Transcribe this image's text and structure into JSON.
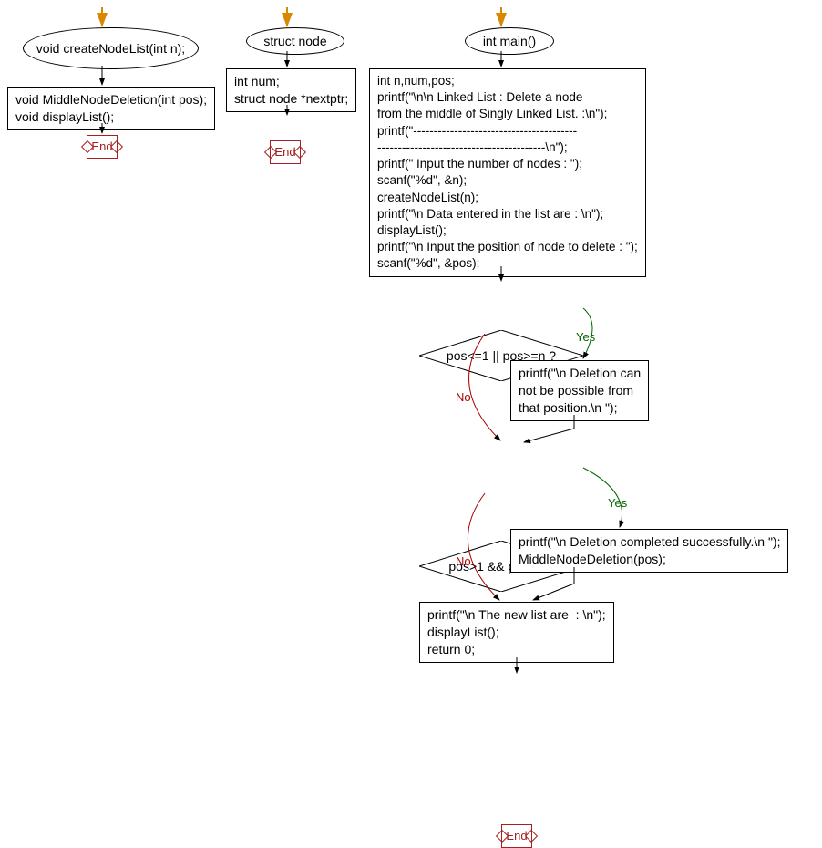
{
  "colA": {
    "start": "void createNodeList(int n);",
    "block": "void MiddleNodeDeletion(int pos);\nvoid displayList();",
    "end": "End"
  },
  "colB": {
    "start": "struct node",
    "block": "int num;\nstruct node *nextptr;",
    "end": "End"
  },
  "colC": {
    "start": "int main()",
    "block1": "int n,num,pos;\nprintf(\"\\n\\n Linked List : Delete a node\nfrom the middle of Singly Linked List. :\\n\");\nprintf(\"----------------------------------------\n-----------------------------------------\\n\");\nprintf(\" Input the number of nodes : \");\nscanf(\"%d\", &n);\ncreateNodeList(n);\nprintf(\"\\n Data entered in the list are : \\n\");\ndisplayList();\nprintf(\"\\n Input the position of node to delete : \");\nscanf(\"%d\", &pos);",
    "cond1": "pos<=1 || pos>=n ?",
    "yesBlock1": "printf(\"\\n Deletion can\nnot be possible from\nthat position.\\n \");",
    "cond2": "pos>1 && pos<n ?",
    "yesBlock2": "printf(\"\\n Deletion completed successfully.\\n \");\nMiddleNodeDeletion(pos);",
    "finalBlock": "printf(\"\\n The new list are  : \\n\");\ndisplayList();\nreturn 0;",
    "end": "End"
  },
  "labels": {
    "yes": "Yes",
    "no": "No"
  },
  "chart_data": {
    "type": "flowchart",
    "subcharts": [
      {
        "id": "A",
        "nodes": [
          {
            "id": "A1",
            "shape": "terminator",
            "text": "void createNodeList(int n);"
          },
          {
            "id": "A2",
            "shape": "process",
            "text": "void MiddleNodeDeletion(int pos);\nvoid displayList();"
          },
          {
            "id": "A3",
            "shape": "end",
            "text": "End"
          }
        ],
        "edges": [
          {
            "from": "entry",
            "to": "A1"
          },
          {
            "from": "A1",
            "to": "A2"
          },
          {
            "from": "A2",
            "to": "A3"
          }
        ]
      },
      {
        "id": "B",
        "nodes": [
          {
            "id": "B1",
            "shape": "terminator",
            "text": "struct node"
          },
          {
            "id": "B2",
            "shape": "process",
            "text": "int num;\nstruct node *nextptr;"
          },
          {
            "id": "B3",
            "shape": "end",
            "text": "End"
          }
        ],
        "edges": [
          {
            "from": "entry",
            "to": "B1"
          },
          {
            "from": "B1",
            "to": "B2"
          },
          {
            "from": "B2",
            "to": "B3"
          }
        ]
      },
      {
        "id": "C",
        "nodes": [
          {
            "id": "C1",
            "shape": "terminator",
            "text": "int main()"
          },
          {
            "id": "C2",
            "shape": "process",
            "text": "int n,num,pos; printf(...); scanf(\"%d\", &n); createNodeList(n); printf(...); displayList(); printf(...); scanf(\"%d\", &pos);"
          },
          {
            "id": "C3",
            "shape": "decision",
            "text": "pos<=1 || pos>=n ?"
          },
          {
            "id": "C4",
            "shape": "process",
            "text": "printf(\"\\n Deletion can not be possible from that position.\\n \");"
          },
          {
            "id": "C5",
            "shape": "decision",
            "text": "pos>1 && pos<n ?"
          },
          {
            "id": "C6",
            "shape": "process",
            "text": "printf(\"\\n Deletion completed successfully.\\n \"); MiddleNodeDeletion(pos);"
          },
          {
            "id": "C7",
            "shape": "process",
            "text": "printf(\"\\n The new list are  : \\n\"); displayList(); return 0;"
          },
          {
            "id": "C8",
            "shape": "end",
            "text": "End"
          }
        ],
        "edges": [
          {
            "from": "entry",
            "to": "C1"
          },
          {
            "from": "C1",
            "to": "C2"
          },
          {
            "from": "C2",
            "to": "C3"
          },
          {
            "from": "C3",
            "to": "C4",
            "label": "Yes"
          },
          {
            "from": "C3",
            "to": "C5",
            "label": "No"
          },
          {
            "from": "C4",
            "to": "C5"
          },
          {
            "from": "C5",
            "to": "C6",
            "label": "Yes"
          },
          {
            "from": "C5",
            "to": "C7",
            "label": "No"
          },
          {
            "from": "C6",
            "to": "C7"
          },
          {
            "from": "C7",
            "to": "C8"
          }
        ]
      }
    ]
  }
}
